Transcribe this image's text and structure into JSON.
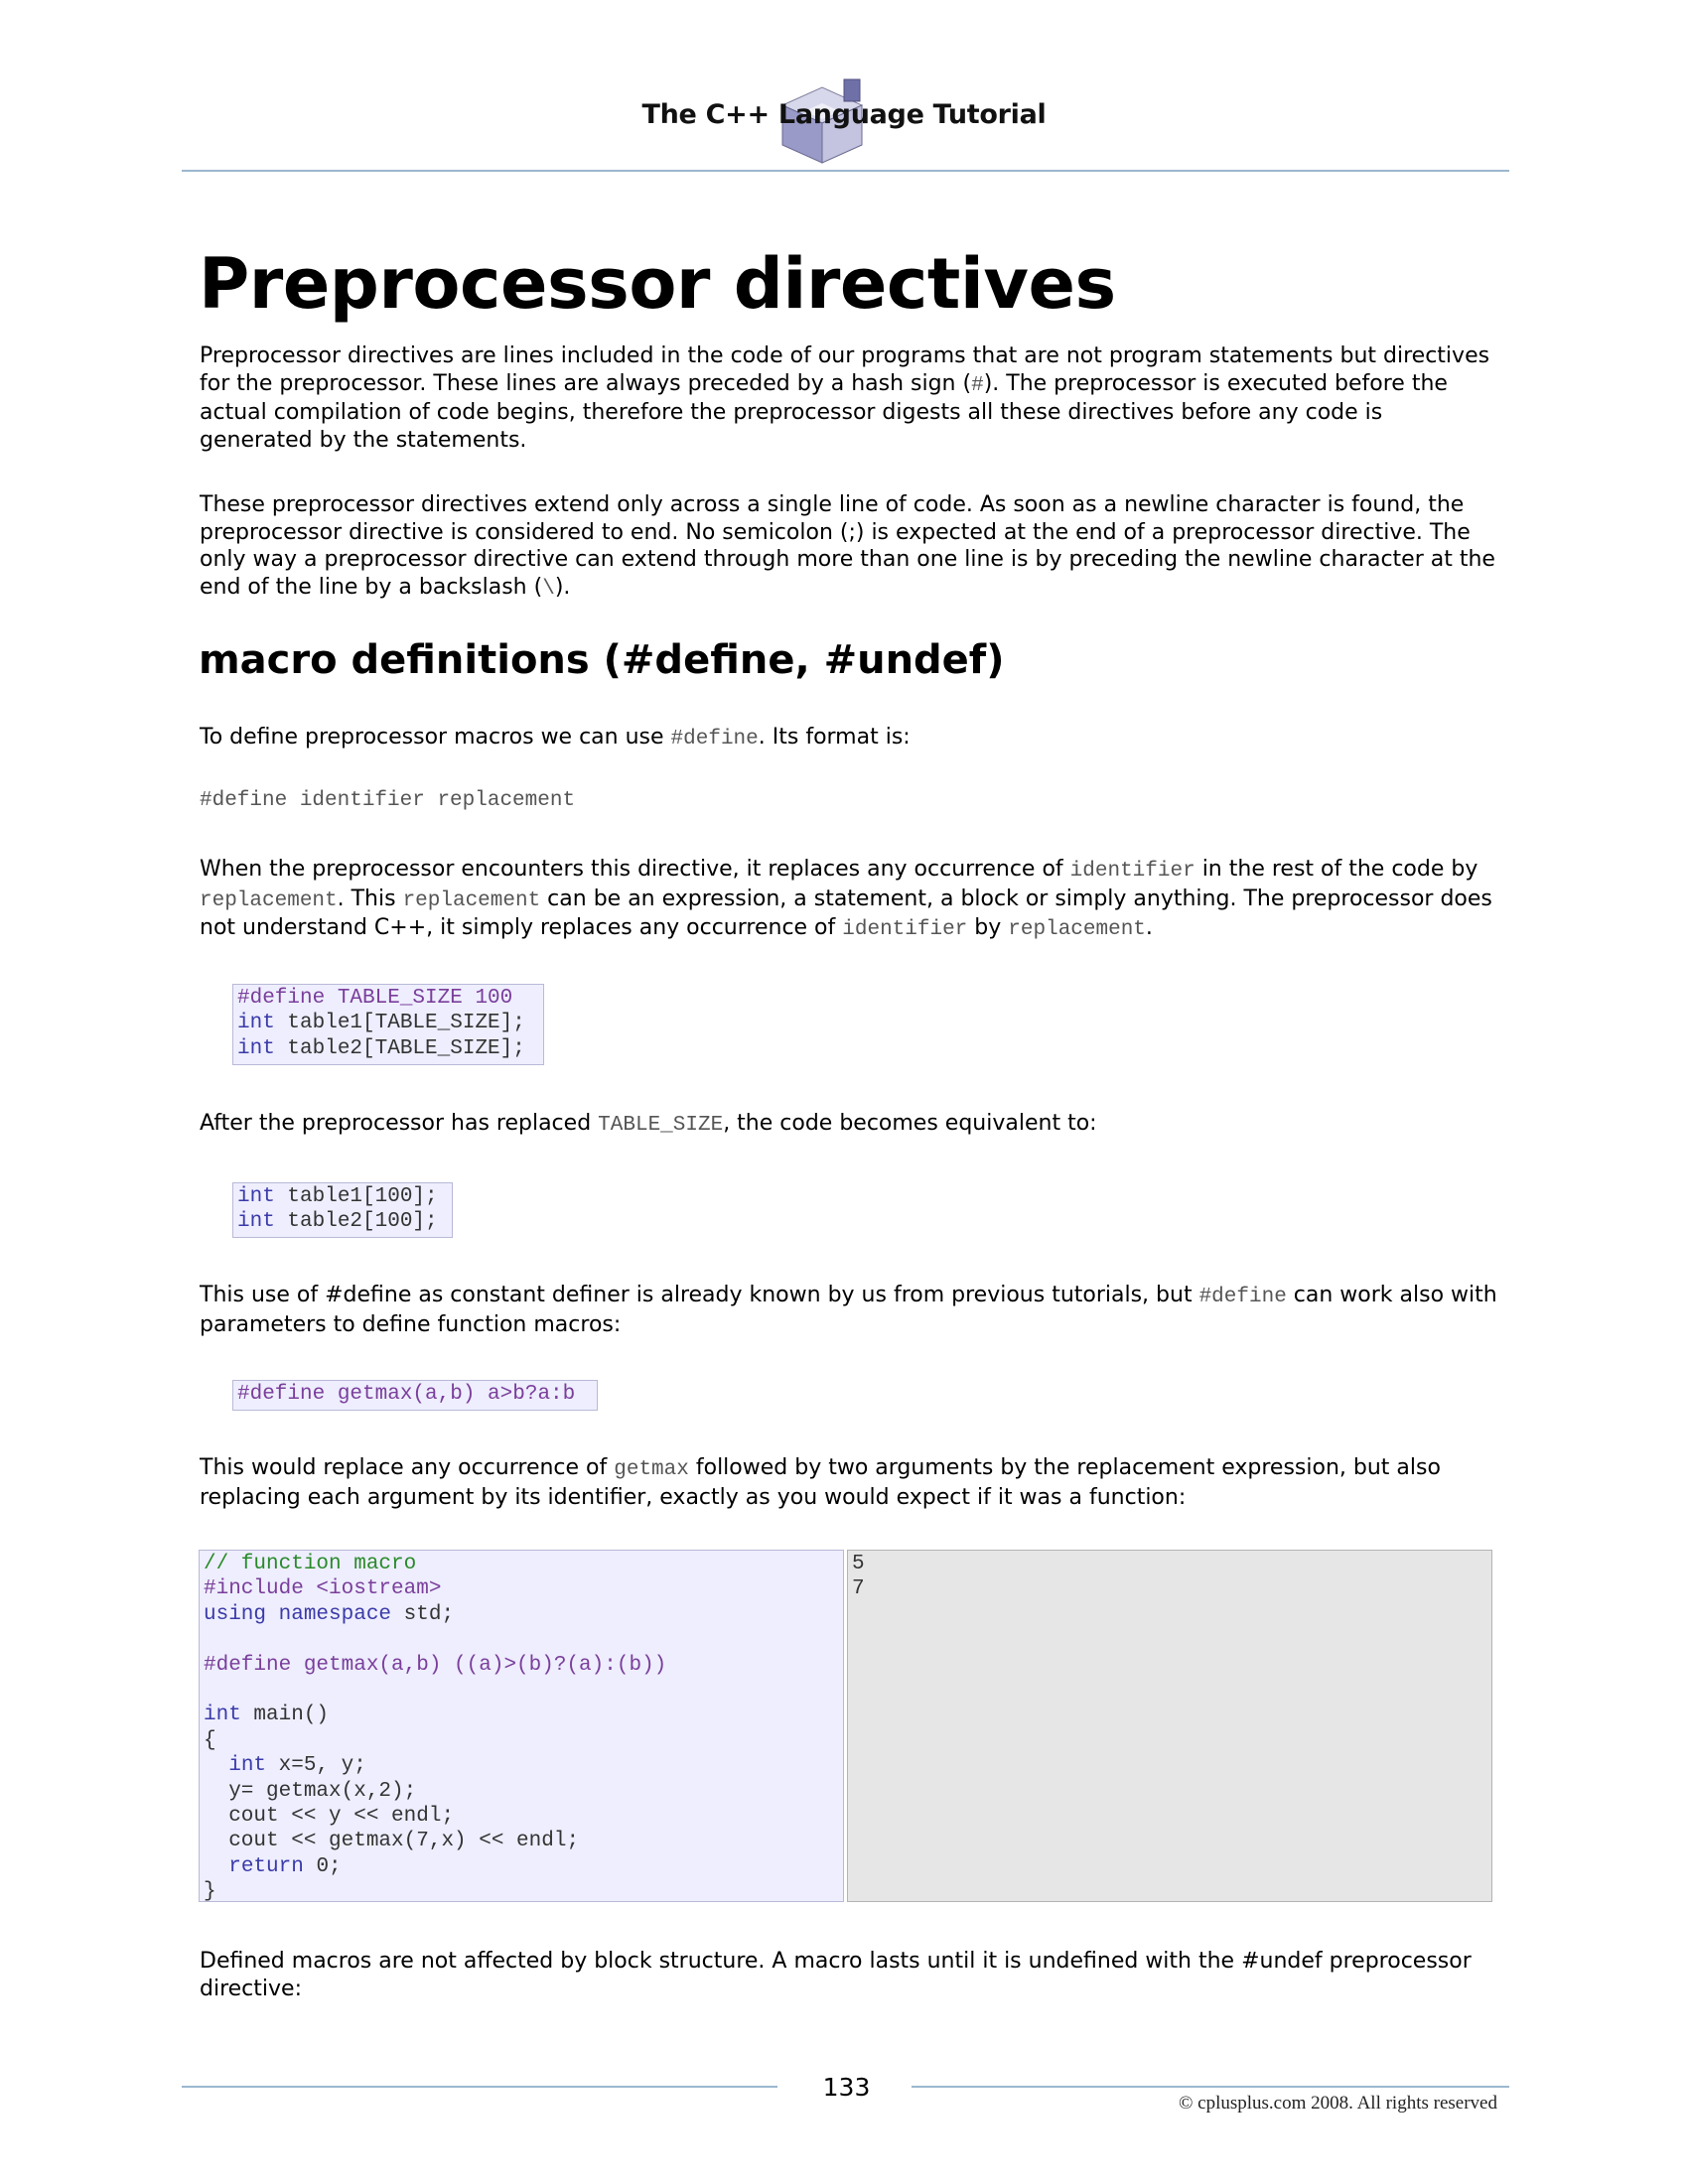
{
  "header": {
    "title": "The C++ Language Tutorial"
  },
  "title": "Preprocessor directives",
  "intro": {
    "p1": {
      "a": "Preprocessor directives are lines included in the code of our programs that are not program statements but directives for the preprocessor. These lines are always preceded by a hash sign (",
      "code": "#",
      "b": "). The preprocessor is executed before the actual compilation of code begins, therefore the preprocessor digests all these directives before any code is generated by the statements."
    },
    "p2": {
      "a": "These preprocessor directives extend only across a single line of code. As soon as a newline character is found, the preprocessor directive is considered to end. No semicolon (;) is expected at the end of a preprocessor directive. The only way a preprocessor directive can extend through more than one line is by preceding the newline character at the end of the line by a backslash (",
      "code": "\\",
      "b": ")."
    }
  },
  "section_macro": {
    "heading": "macro definitions (#define, #undef)",
    "p1": {
      "a": "To define preprocessor macros we can use ",
      "code": "#define",
      "b": ". Its format is:"
    },
    "syntax": "#define identifier replacement",
    "p2": {
      "a": "When the preprocessor encounters this directive, it replaces any occurrence of ",
      "c1": "identifier",
      "b": " in the rest of the code by ",
      "c2": "replacement",
      "c": ". This ",
      "c3": "replacement",
      "d": " can be an expression, a statement, a block or simply anything. The preprocessor does not understand C++, it simply replaces any occurrence of ",
      "c4": "identifier",
      "e": " by ",
      "c5": "replacement",
      "f": "."
    },
    "code1": {
      "l1": "#define TABLE_SIZE 100",
      "l2kw": "int",
      "l2": " table1[TABLE_SIZE];",
      "l3kw": "int",
      "l3": " table2[TABLE_SIZE];"
    },
    "p3": {
      "a": "After the preprocessor has replaced ",
      "code": "TABLE_SIZE",
      "b": ", the code becomes equivalent to:"
    },
    "code2": {
      "l1kw": "int",
      "l1": " table1[100];",
      "l2kw": "int",
      "l2": " table2[100];"
    },
    "p4": {
      "a": "This use of #define as constant definer is already known by us from previous tutorials, but ",
      "code": "#define",
      "b": " can work also with parameters to define function macros:"
    },
    "code3": "#define getmax(a,b) a>b?a:b",
    "p5": {
      "a": "This would replace any occurrence of ",
      "code": "getmax",
      "b": " followed by two arguments by the replacement expression, but also replacing each argument by its identifier, exactly as you would expect if it was a function:"
    },
    "example": {
      "l1": "// function macro",
      "l2": "#include <iostream>",
      "l3kw": "using namespace",
      "l3": " std;",
      "l5": "#define getmax(a,b) ((a)>(b)?(a):(b))",
      "l7kw": "int",
      "l7": " main()",
      "l8": "{",
      "l9pre": "  ",
      "l9kw": "int",
      "l9": " x=5, y;",
      "l10": "  y= getmax(x,2);",
      "l11": "  cout << y << endl;",
      "l12": "  cout << getmax(7,x) << endl;",
      "l13pre": "  ",
      "l13kw": "return",
      "l13": " 0;",
      "l14": "}"
    },
    "output": [
      "5",
      "7"
    ],
    "p6": "Defined macros are not affected by block structure. A macro lasts until it is undefined with the #undef preprocessor directive:"
  },
  "footer": {
    "page_number": "133",
    "copyright": "© cplusplus.com 2008. All rights reserved"
  }
}
